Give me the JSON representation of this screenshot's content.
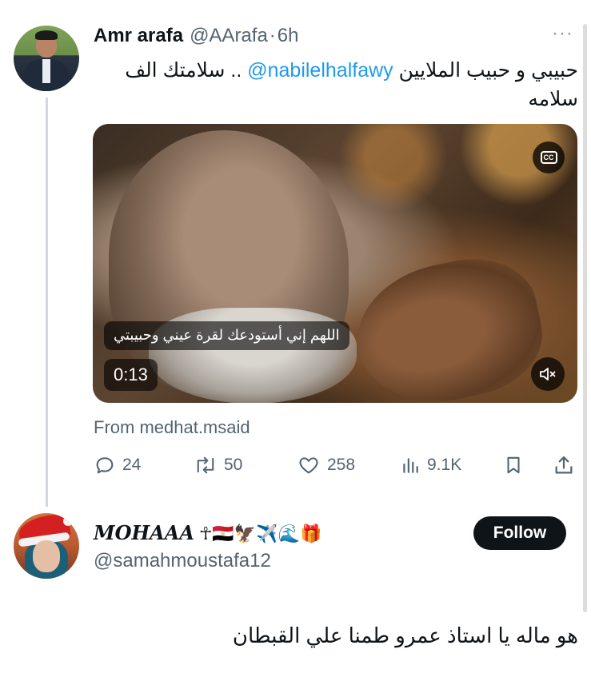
{
  "tweet": {
    "author_name": "Amr arafa",
    "author_handle": "@AArafa",
    "separator": "·",
    "time": "6h",
    "more_label": "···",
    "text_before": "حبيبي و حبيب الملايين ",
    "mention": "@nabilelhalfawy",
    "text_after": " .. سلامتك الف سلامه",
    "video": {
      "cc_label": "CC",
      "caption": "اللهم إني أستودعك لقرة عيني وحبيبتي",
      "duration": "0:13",
      "muted": true
    },
    "from": "From medhat.msaid",
    "actions": {
      "replies": "24",
      "retweets": "50",
      "likes": "258",
      "views": "9.1K"
    }
  },
  "reply": {
    "display_name": "MOHAAA",
    "name_emojis": "☥🇪🇬🦅✈️🌊🎁",
    "handle": "@samahmoustafa12",
    "follow_label": "Follow",
    "text": "هو ماله يا استاذ عمرو طمنا علي القبطان"
  },
  "colors": {
    "link": "#1d9bf0",
    "secondary_text": "#536471",
    "primary_text": "#0f1419",
    "follow_bg": "#0f1419"
  }
}
